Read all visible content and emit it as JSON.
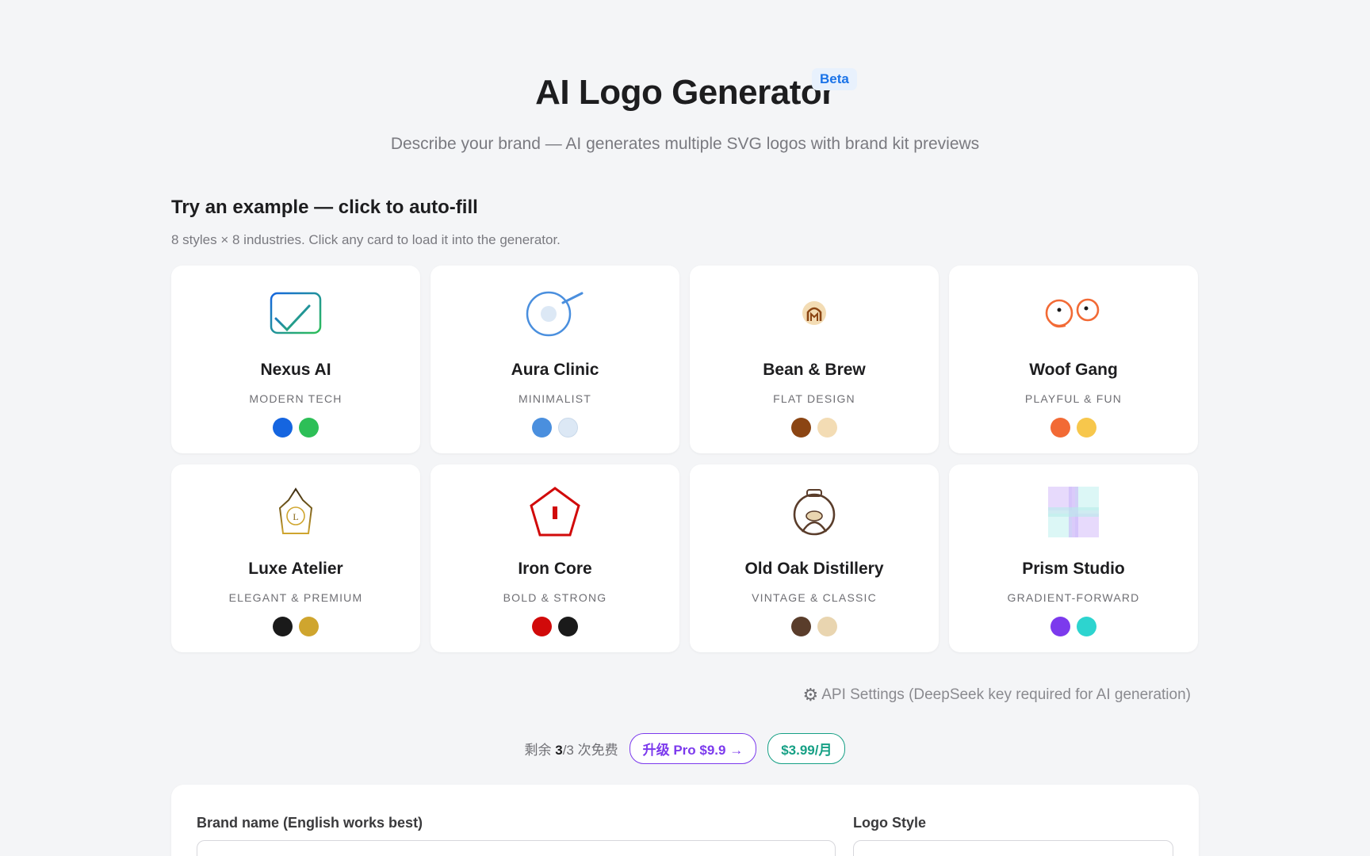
{
  "header": {
    "title": "AI Logo Generator",
    "badge": "Beta",
    "subtitle": "Describe your brand — AI generates multiple SVG logos with brand kit previews"
  },
  "examples": {
    "title": "Try an example — click to auto-fill",
    "subtitle": "8 styles × 8 industries. Click any card to load it into the generator.",
    "cards": [
      {
        "name": "Nexus AI",
        "style": "MODERN TECH",
        "icon": "checkbox-check-icon",
        "colors": [
          "#1565e0",
          "#2dbf57"
        ]
      },
      {
        "name": "Aura Clinic",
        "style": "MINIMALIST",
        "icon": "circle-orbit-icon",
        "colors": [
          "#4a8fde",
          "#dce8f5"
        ]
      },
      {
        "name": "Bean & Brew",
        "style": "FLAT DESIGN",
        "icon": "coffee-bean-icon",
        "colors": [
          "#8b4513",
          "#f3dcb4"
        ]
      },
      {
        "name": "Woof Gang",
        "style": "PLAYFUL & FUN",
        "icon": "dog-eyes-icon",
        "colors": [
          "#f26a35",
          "#f7c74c"
        ]
      },
      {
        "name": "Luxe Atelier",
        "style": "ELEGANT & PREMIUM",
        "icon": "pentagon-monogram-icon",
        "colors": [
          "#1a1a1a",
          "#cfa52e"
        ]
      },
      {
        "name": "Iron Core",
        "style": "BOLD & STRONG",
        "icon": "pentagon-bar-icon",
        "colors": [
          "#d10a0a",
          "#1a1a1a"
        ]
      },
      {
        "name": "Old Oak Distillery",
        "style": "VINTAGE & CLASSIC",
        "icon": "barrel-badge-icon",
        "colors": [
          "#5a3d2b",
          "#e9d5b0"
        ]
      },
      {
        "name": "Prism Studio",
        "style": "GRADIENT-FORWARD",
        "icon": "prism-blocks-icon",
        "colors": [
          "#7c3aed",
          "#2dd4cf"
        ]
      }
    ]
  },
  "api_settings": {
    "icon": "gear-icon",
    "label": "API Settings (DeepSeek key required for AI generation)"
  },
  "quota": {
    "prefix": "剩余 ",
    "remaining": "3",
    "suffix": "/3 次免费",
    "upgrade_label": "升级 Pro $9.9 →",
    "monthly_label": "$3.99/月"
  },
  "form": {
    "brand_label": "Brand name (English works best)",
    "style_label": "Logo Style"
  }
}
